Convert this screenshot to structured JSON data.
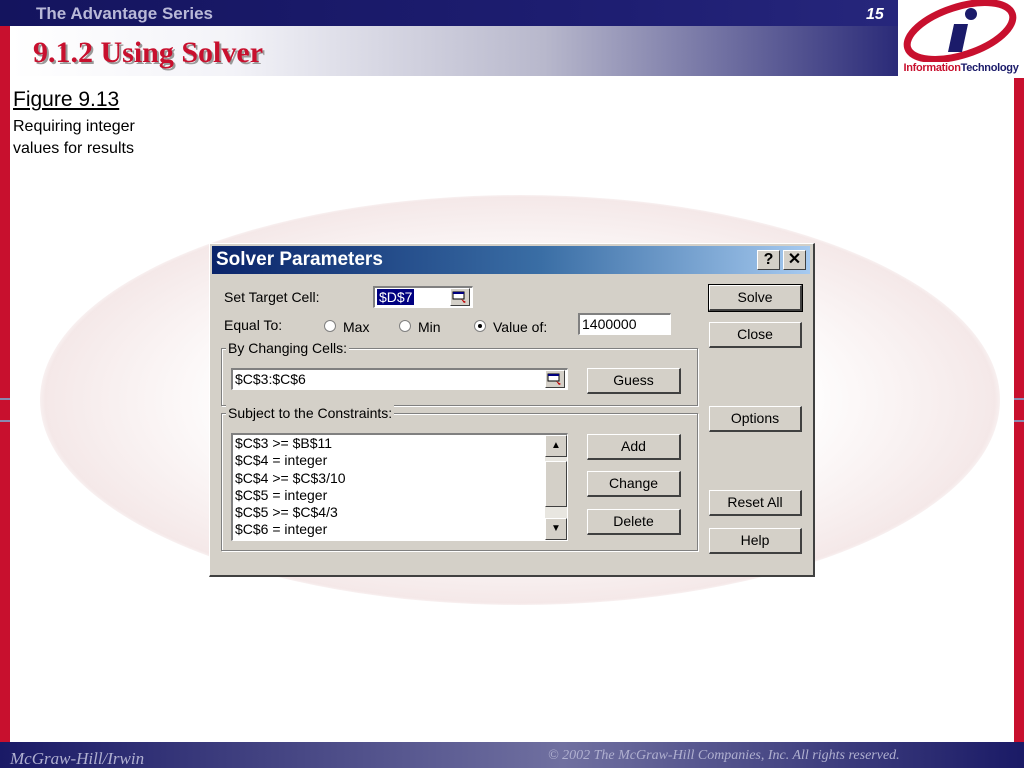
{
  "slide": {
    "series": "The Advantage Series",
    "page_number": "15",
    "title": "9.1.2 Using Solver",
    "figure_number": "Figure 9.13",
    "figure_caption": "Requiring integer values for results",
    "logo_text_a": "Information",
    "logo_text_b": "Technology",
    "footer_left": "McGraw-Hill/Irwin",
    "footer_right": "© 2002  The McGraw-Hill Companies, Inc. All rights reserved.",
    "colors": {
      "accent_red": "#c8102e",
      "navy": "#1b1b6a",
      "dialog_gray": "#d4d0c8"
    }
  },
  "dialog": {
    "title": "Solver Parameters",
    "help_btn": "?",
    "close_btn": "✕",
    "target_label": "Set Target Cell:",
    "target_value": "$D$7",
    "equal_to_label": "Equal To:",
    "radio_max": "Max",
    "radio_min": "Min",
    "radio_value": "Value of:",
    "selected_option": "Value of:",
    "value_of": "1400000",
    "changing_label": "By Changing Cells:",
    "changing_value": "$C$3:$C$6",
    "guess_btn": "Guess",
    "constraints_label": "Subject to the Constraints:",
    "constraints": [
      "$C$3 >= $B$11",
      "$C$4 = integer",
      "$C$4 >= $C$3/10",
      "$C$5 = integer",
      "$C$5 >= $C$4/3",
      "$C$6 = integer"
    ],
    "add_btn": "Add",
    "change_btn": "Change",
    "delete_btn": "Delete",
    "solve_btn": "Solve",
    "close_dialog_btn": "Close",
    "options_btn": "Options",
    "reset_btn": "Reset All",
    "help_dialog_btn": "Help"
  }
}
